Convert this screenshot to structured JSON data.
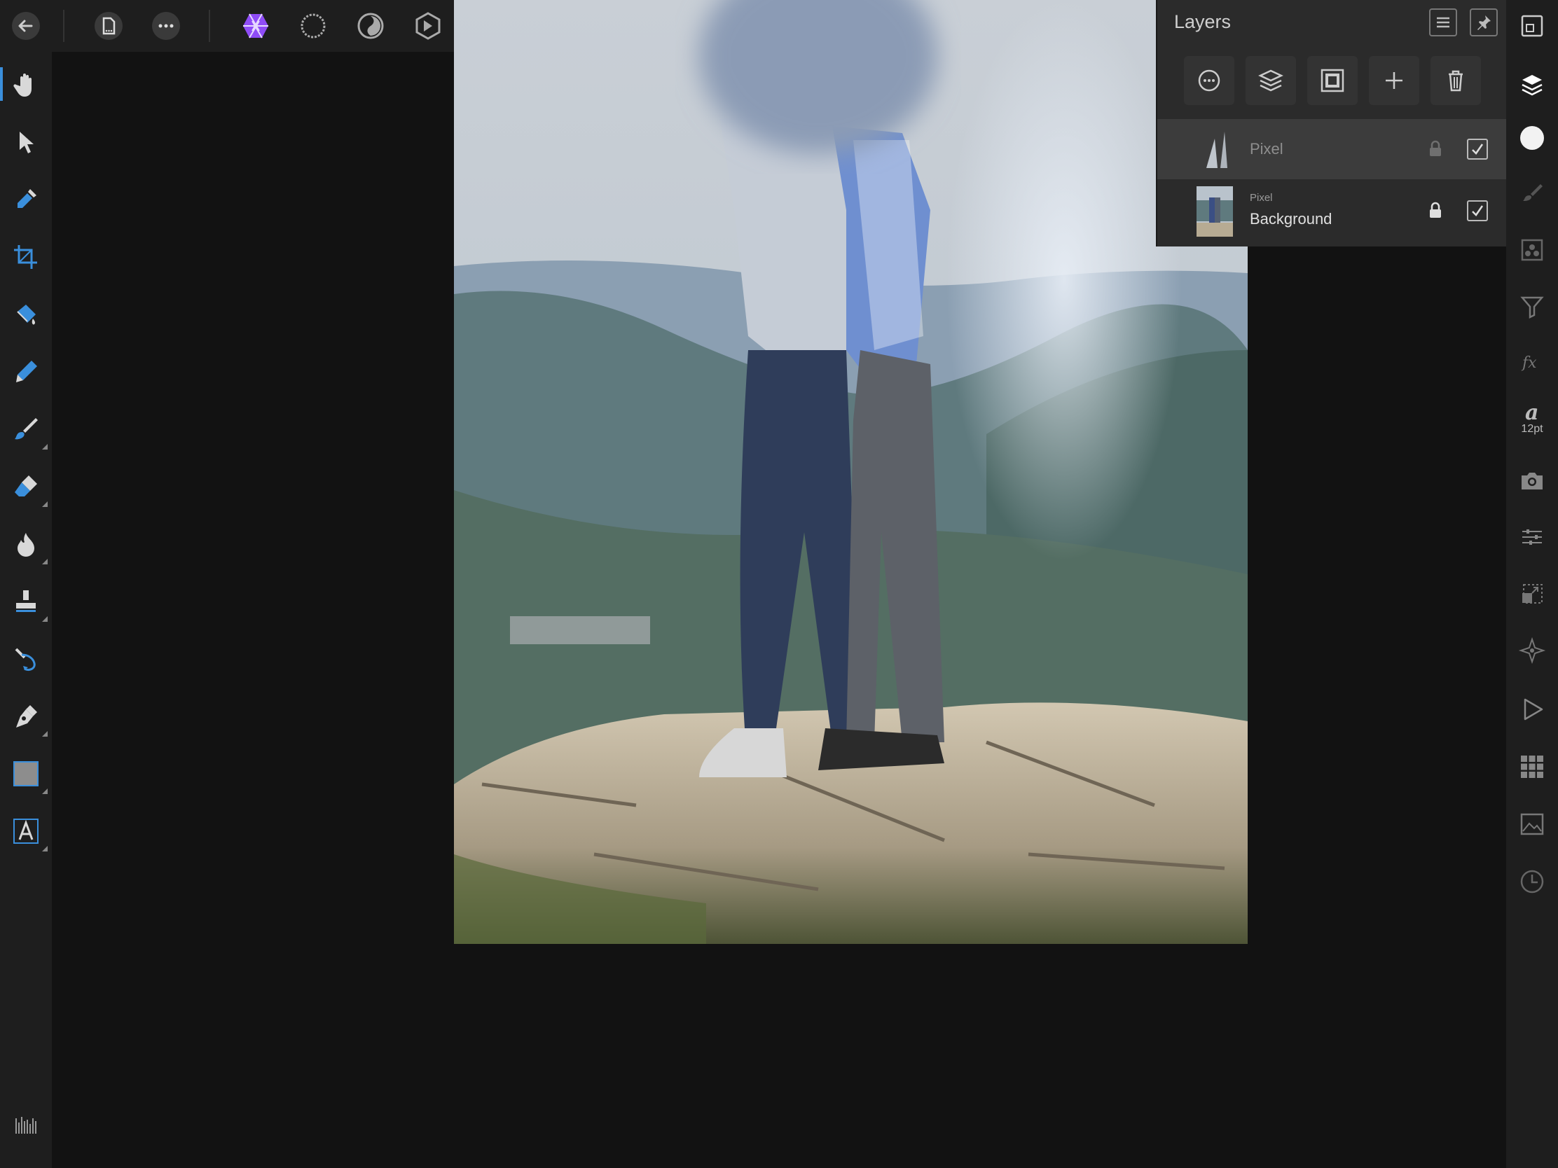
{
  "layers_panel": {
    "title": "Layers",
    "layers": [
      {
        "name": "Pixel",
        "type": "",
        "selected": true
      },
      {
        "name": "Background",
        "type": "Pixel",
        "selected": false
      }
    ]
  },
  "right_bar": {
    "font_size_label": "12pt"
  },
  "colors": {
    "accent": "#8f4cf7",
    "tool_blue": "#3a8fdc",
    "bar_bg": "#1e1e1e",
    "canvas_bg": "#121212",
    "panel_bg": "#2b2b2b"
  },
  "icons": {
    "top": [
      "back-arrow-icon",
      "document-icon",
      "more-icon",
      "photo-persona-icon",
      "liquify-persona-icon",
      "develop-persona-icon",
      "tone-mapping-persona-icon",
      "histogram-icon",
      "export-persona-icon"
    ],
    "left": [
      "hand-icon",
      "move-icon",
      "eyedropper-icon",
      "crop-icon",
      "flood-fill-icon",
      "selection-brush-icon",
      "paint-brush-icon",
      "erase-brush-icon",
      "burn-icon",
      "clone-stamp-icon",
      "healing-icon",
      "pen-icon",
      "rectangle-icon",
      "text-icon",
      "brush-settings-icon"
    ],
    "right": [
      "navigator-icon",
      "layers-icon",
      "color-icon",
      "brushes-icon",
      "channels-icon",
      "adjustments-icon",
      "effects-icon",
      "text-style-icon",
      "snapshot-icon",
      "transform-icon",
      "placement-icon",
      "navigator-compass-icon",
      "macro-play-icon",
      "stock-grid-icon",
      "image-icon",
      "history-icon"
    ]
  }
}
